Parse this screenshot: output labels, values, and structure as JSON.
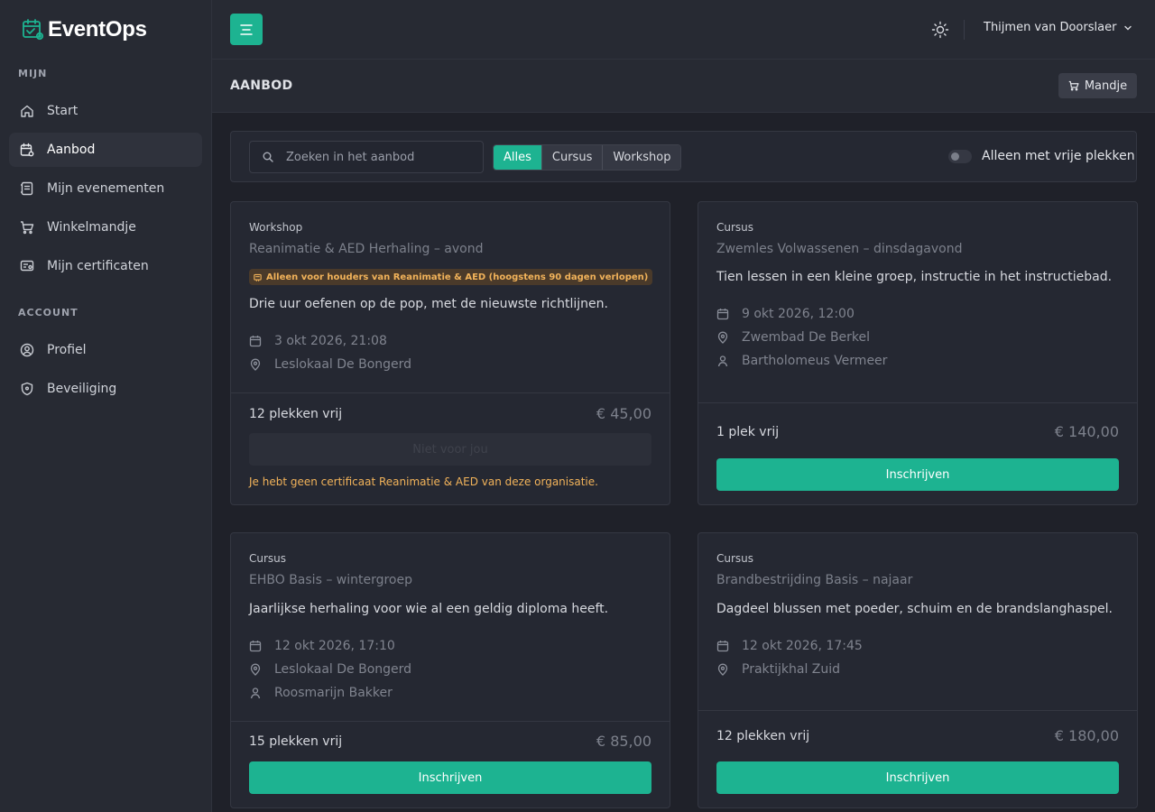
{
  "app": {
    "name": "EventOps"
  },
  "sidebar": {
    "section_mijn": "MIJN",
    "section_account": "ACCOUNT",
    "items": [
      {
        "label": "Start",
        "icon": "home-icon"
      },
      {
        "label": "Aanbod",
        "icon": "calendar-icon",
        "active": true
      },
      {
        "label": "Mijn evenementen",
        "icon": "agenda-icon"
      },
      {
        "label": "Winkelmandje",
        "icon": "cart-icon"
      },
      {
        "label": "Mijn certificaten",
        "icon": "certificate-icon"
      },
      {
        "label": "Profiel",
        "icon": "user-circle-icon"
      },
      {
        "label": "Beveiliging",
        "icon": "shield-icon"
      }
    ]
  },
  "topbar": {
    "user_name": "Thijmen van Doorslaer"
  },
  "page": {
    "title": "AANBOD",
    "cart_label": "Mandje"
  },
  "filters": {
    "search_placeholder": "Zoeken in het aanbod",
    "segments": [
      "Alles",
      "Cursus",
      "Workshop"
    ],
    "active_segment": "Alles",
    "toggle_label": "Alleen met vrije plekken",
    "toggle_on": false
  },
  "cards": [
    {
      "type": "Workshop",
      "title": "Reanimatie & AED Herhaling – avond",
      "badge": "Alleen voor houders van Reanimatie & AED (hoogstens 90 dagen verlopen)",
      "description": "Drie uur oefenen op de pop, met de nieuwste richtlijnen.",
      "date": "3 okt 2026, 21:08",
      "location": "Leslokaal De Bongerd",
      "spots": "12 plekken vrij",
      "price": "€ 45,00",
      "button": "Niet voor jou",
      "warning": "Je hebt geen certificaat Reanimatie & AED van deze organisatie."
    },
    {
      "type": "Cursus",
      "title": "Zwemles Volwassenen – dinsdagavond",
      "description": "Tien lessen in een kleine groep, instructie in het instructiebad.",
      "date": "9 okt 2026, 12:00",
      "location": "Zwembad De Berkel",
      "instructor": "Bartholomeus Vermeer",
      "spots": "1 plek vrij",
      "price": "€ 140,00",
      "button": "Inschrijven"
    },
    {
      "type": "Cursus",
      "title": "EHBO Basis – wintergroep",
      "description": "Jaarlijkse herhaling voor wie al een geldig diploma heeft.",
      "date": "12 okt 2026, 17:10",
      "location": "Leslokaal De Bongerd",
      "instructor": "Roosmarijn Bakker",
      "spots": "15 plekken vrij",
      "price": "€ 85,00",
      "button": "Inschrijven"
    },
    {
      "type": "Cursus",
      "title": "Brandbestrijding Basis – najaar",
      "description": "Dagdeel blussen met poeder, schuim en de brandslanghaspel.",
      "date": "12 okt 2026, 17:45",
      "location": "Praktijkhal Zuid",
      "spots": "12 plekken vrij",
      "price": "€ 180,00",
      "button": "Inschrijven"
    }
  ],
  "colors": {
    "accent": "#1db391",
    "warning": "#f2b35a",
    "background": "#1f2129",
    "surface": "#252832"
  }
}
